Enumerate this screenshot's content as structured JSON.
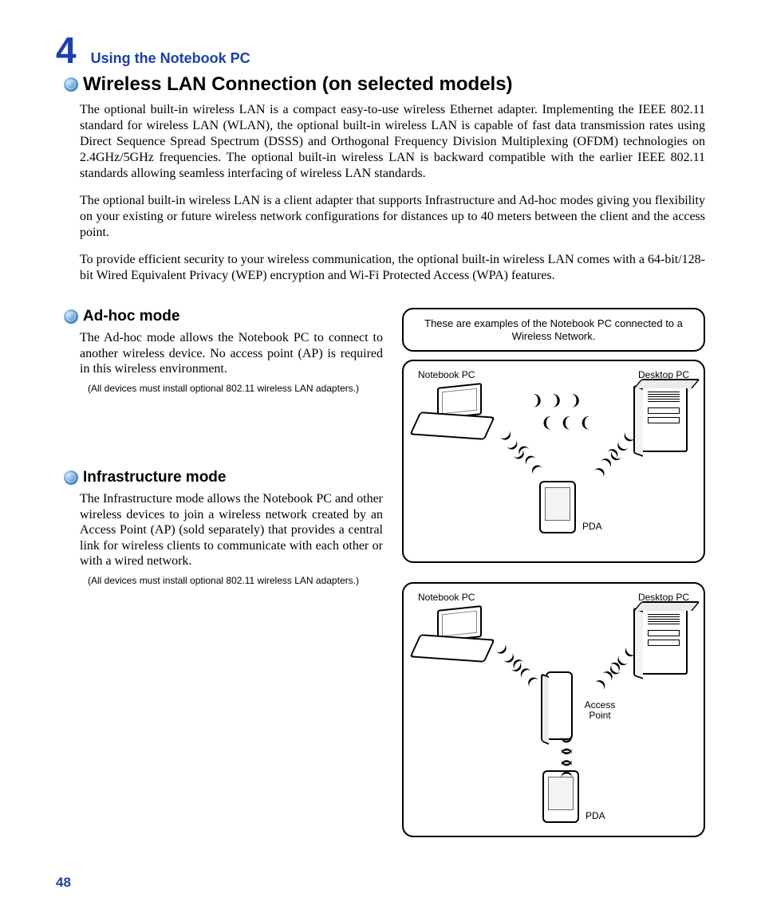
{
  "chapter": {
    "number": "4",
    "title": "Using the Notebook PC"
  },
  "section_title": "Wireless LAN Connection (on selected models)",
  "para1": "The optional built-in wireless LAN is a compact easy-to-use wireless Ethernet adapter. Implementing the IEEE 802.11 standard for wireless LAN (WLAN), the optional built-in wireless LAN is capable of fast data transmission rates using Direct Sequence Spread Spectrum (DSSS) and Orthogonal Frequency Division Multiplexing (OFDM) technologies on 2.4GHz/5GHz frequencies. The optional built-in wireless LAN is backward compatible with the earlier IEEE 802.11 standards allowing seamless interfacing of wireless LAN standards.",
  "para2": "The optional built-in wireless LAN is a client adapter that supports Infrastructure and Ad-hoc modes giving you flexibility on your existing or future wireless network configurations for distances up to 40 meters between the client and the access point.",
  "para3": "To provide efficient security to your wireless communication, the optional built-in wireless LAN comes with a 64-bit/128-bit Wired Equivalent Privacy (WEP) encryption and Wi-Fi Protected Access (WPA) features.",
  "adhoc": {
    "title": "Ad-hoc mode",
    "text": "The Ad-hoc mode allows the Notebook PC to connect to another wireless device. No access point (AP) is required in this wireless environment.",
    "note": "(All devices must install optional 802.11 wireless LAN adapters.)"
  },
  "infra": {
    "title": "Infrastructure mode",
    "text": "The Infrastructure mode allows the Notebook PC and other wireless devices to join a wireless network created by an Access Point (AP) (sold separately) that provides a central link for wireless clients to communicate with each other or with a wired network.",
    "note": "(All devices must install optional 802.11 wireless LAN adapters.)"
  },
  "diagram_caption": "These are examples of the Notebook PC connected to a Wireless Network.",
  "labels": {
    "notebook": "Notebook PC",
    "desktop": "Desktop PC",
    "pda": "PDA",
    "ap": "Access Point"
  },
  "page_number": "48"
}
